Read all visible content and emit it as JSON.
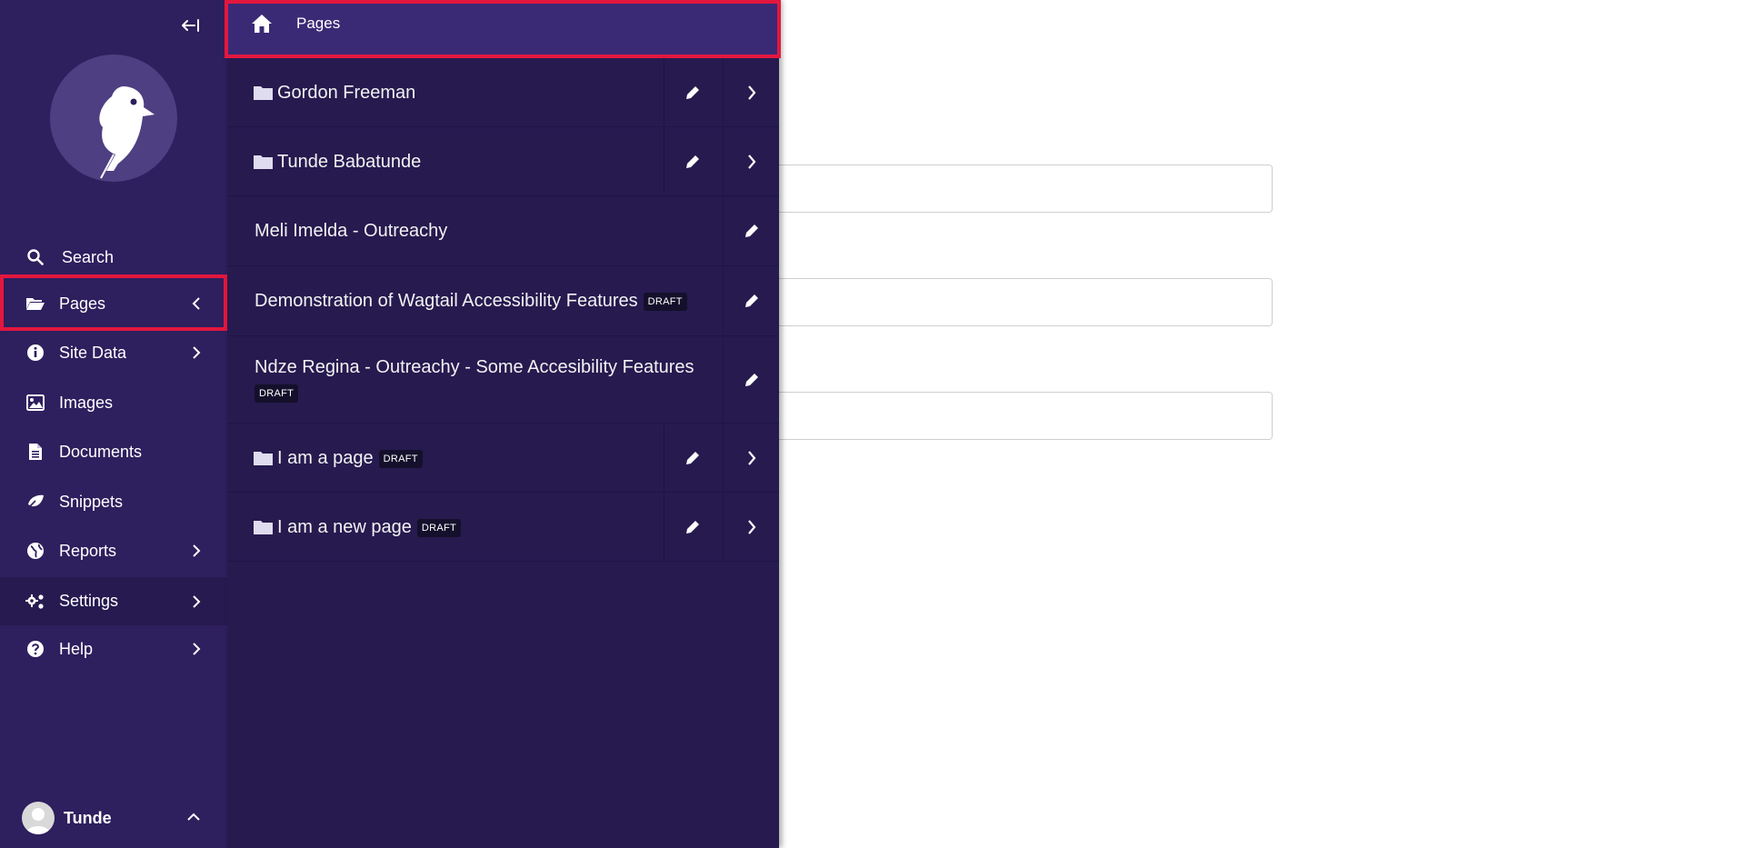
{
  "sidebar": {
    "collapse_icon": "collapse-arrow-icon",
    "items": [
      {
        "label": "Search",
        "icon": "search-icon",
        "chevron": ""
      },
      {
        "label": "Pages",
        "icon": "folder-open-icon",
        "chevron": "chevron-left-icon"
      },
      {
        "label": "Site Data",
        "icon": "info-circle-icon",
        "chevron": "chevron-right-icon"
      },
      {
        "label": "Images",
        "icon": "image-icon",
        "chevron": ""
      },
      {
        "label": "Documents",
        "icon": "document-icon",
        "chevron": ""
      },
      {
        "label": "Snippets",
        "icon": "snippet-icon",
        "chevron": ""
      },
      {
        "label": "Reports",
        "icon": "globe-icon",
        "chevron": "chevron-right-icon"
      },
      {
        "label": "Settings",
        "icon": "cogs-icon",
        "chevron": "chevron-right-icon"
      },
      {
        "label": "Help",
        "icon": "help-icon",
        "chevron": "chevron-right-icon"
      }
    ],
    "user": {
      "name": "Tunde"
    }
  },
  "explorer": {
    "header": {
      "label": "Pages",
      "icon": "home-icon"
    },
    "draft_label": "DRAFT",
    "rows": [
      {
        "title": "Gordon Freeman",
        "has_children": true,
        "draft": false
      },
      {
        "title": "Tunde Babatunde",
        "has_children": true,
        "draft": false
      },
      {
        "title": "Meli Imelda - Outreachy",
        "has_children": false,
        "draft": false
      },
      {
        "title": "Demonstration of Wagtail Accessibility Features",
        "has_children": false,
        "draft": true
      },
      {
        "title": "Ndze Regina - Outreachy - Some Accesibility Features",
        "has_children": false,
        "draft": true
      },
      {
        "title": "I am a page",
        "has_children": true,
        "draft": true
      },
      {
        "title": "I am a new page",
        "has_children": true,
        "draft": true
      }
    ]
  },
  "colors": {
    "sidebar_bg": "#2e1f5e",
    "explorer_bg": "#261a4f",
    "explorer_header_bg": "#3a2a75",
    "highlight": "#e3173e"
  }
}
